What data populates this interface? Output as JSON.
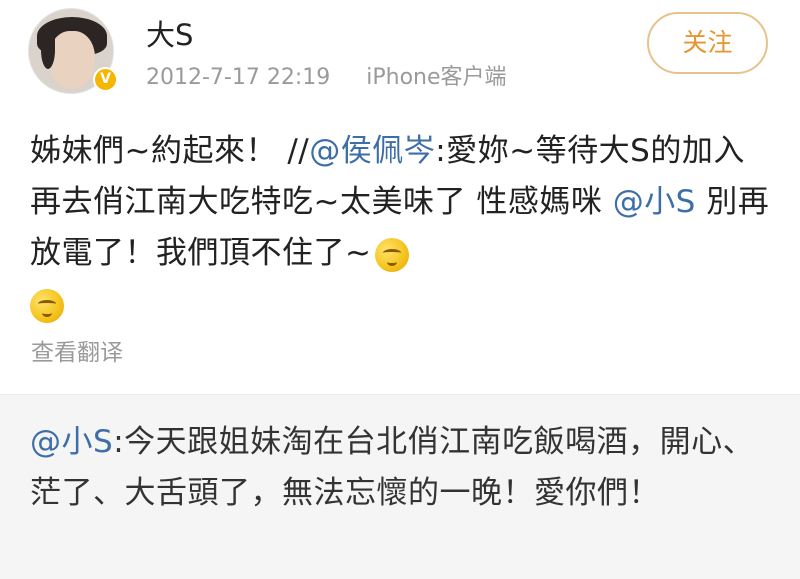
{
  "user": {
    "name": "大S",
    "verified_icon": "verified-badge-icon",
    "badge_color": "#f5b600"
  },
  "meta": {
    "timestamp": "2012-7-17 22:19",
    "source": "iPhone客户端"
  },
  "follow_button": {
    "label": "关注",
    "accent": "#e7952f"
  },
  "post": {
    "segments": [
      {
        "text": "姊妹們~約起來！ //",
        "kind": "plain"
      },
      {
        "text": "@侯佩岑",
        "kind": "mention"
      },
      {
        "text": ":愛妳~等待大S的加入 再去俏江南大吃特吃~太美味了 性感媽咪 ",
        "kind": "plain"
      },
      {
        "text": "@小S",
        "kind": "mention"
      },
      {
        "text": " 別再放電了！我們頂不住了~",
        "kind": "plain"
      }
    ],
    "emoji": [
      "grinning-face-icon",
      "grinning-face-icon"
    ],
    "translate_label": "查看翻译"
  },
  "quoted": {
    "mention": "@小S",
    "text": ":今天跟姐妹淘在台北俏江南吃飯喝酒，開心、茫了、大舌頭了，無法忘懷的一晚！愛你們！"
  },
  "colors": {
    "mention": "#3d6ea8",
    "quoted_background": "#f5f5f5"
  }
}
